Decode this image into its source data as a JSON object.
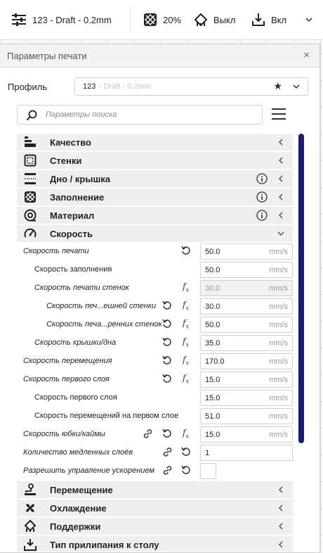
{
  "topbar": {
    "profile_name": "123 - Draft - 0.2mm",
    "infill_value": "20%",
    "support_value": "Выкл",
    "adhesion_value": "Вкл"
  },
  "panel": {
    "title": "Параметры печати",
    "close": "×",
    "profile_label": "Профиль",
    "profile_number": "123",
    "profile_rest": "- Draft - 0.2mm",
    "search_placeholder": "Параметры поиска"
  },
  "categories_top": [
    {
      "label": "Качество",
      "icon": "quality-icon",
      "info": false,
      "expanded": false
    },
    {
      "label": "Стенки",
      "icon": "walls-icon",
      "info": false,
      "expanded": false
    },
    {
      "label": "Дно / крышка",
      "icon": "topbottom-icon",
      "info": true,
      "expanded": false
    },
    {
      "label": "Заполнение",
      "icon": "infill-icon",
      "info": true,
      "expanded": false
    },
    {
      "label": "Материал",
      "icon": "material-icon",
      "info": true,
      "expanded": false
    },
    {
      "label": "Скорость",
      "icon": "speed-icon",
      "info": false,
      "expanded": true
    }
  ],
  "settings": [
    {
      "label": "Скорость печати",
      "value": "50.0",
      "unit": "mm/s"
    },
    {
      "label": "Скорость заполнения",
      "value": "50.0",
      "unit": "mm/s"
    },
    {
      "label": "Скорость печати стенок",
      "value": "30.0",
      "unit": "mm/s"
    },
    {
      "label": "Скорость печ...ешней стенки",
      "value": "30.0",
      "unit": "mm/s"
    },
    {
      "label": "Скорость печа...ренних стенок",
      "value": "50.0",
      "unit": "mm/s"
    },
    {
      "label": "Скорость крышки/дна",
      "value": "35.0",
      "unit": "mm/s"
    },
    {
      "label": "Скорость перемещения",
      "value": "170.0",
      "unit": "mm/s"
    },
    {
      "label": "Скорость первого слоя",
      "value": "15.0",
      "unit": "mm/s"
    },
    {
      "label": "Скорость первого слоя",
      "value": "15.0",
      "unit": "mm/s"
    },
    {
      "label": "Скорость перемещений на первом слое",
      "value": "51.0",
      "unit": "mm/s"
    },
    {
      "label": "Скорость юбки/каймы",
      "value": "15.0",
      "unit": "mm/s"
    },
    {
      "label": "Количество медленных слоёв",
      "value": "1",
      "unit": ""
    },
    {
      "label": "Разрешить управление ускорением",
      "value": "",
      "unit": ""
    }
  ],
  "fx_symbol": "f",
  "categories_bottom": [
    {
      "label": "Перемещение",
      "icon": "travel-icon"
    },
    {
      "label": "Охлаждение",
      "icon": "cooling-icon"
    },
    {
      "label": "Поддержки",
      "icon": "support-icon"
    },
    {
      "label": "Тип прилипания к столу",
      "icon": "adhesion-icon"
    }
  ],
  "colors": {
    "scrollbar": "#1c1c78",
    "category_bg": "#efefef"
  }
}
